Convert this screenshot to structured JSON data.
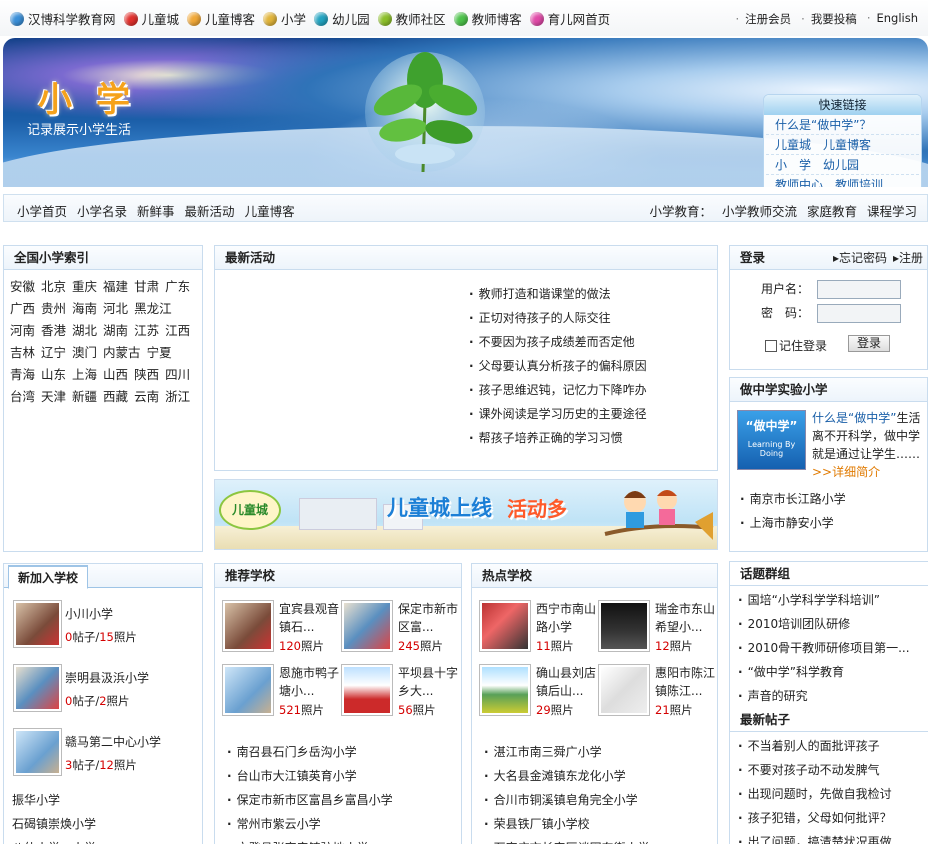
{
  "topnav": [
    {
      "label": "汉博科学教育网",
      "color": "#3a8fd8"
    },
    {
      "label": "儿童城",
      "color": "#e0302c"
    },
    {
      "label": "儿童博客",
      "color": "#f0a838"
    },
    {
      "label": "小学",
      "color": "#e0b43a"
    },
    {
      "label": "幼儿园",
      "color": "#22a3c0"
    },
    {
      "label": "教师社区",
      "color": "#8cbf2a"
    },
    {
      "label": "教师博客",
      "color": "#4cc24a"
    },
    {
      "label": "育儿网首页",
      "color": "#e04aa8"
    }
  ],
  "toplinks": [
    "注册会员",
    "我要投稿",
    "English"
  ],
  "banner": {
    "title": "小学",
    "subtitle": "记录展示小学生活"
  },
  "quick": {
    "title": "快速链接",
    "rows": [
      [
        "什么是“做中学”？"
      ],
      [
        "儿童城",
        "儿童博客"
      ],
      [
        "小　学",
        "幼儿园"
      ],
      [
        "教师中心",
        "教师培训"
      ]
    ]
  },
  "subnav": {
    "left": [
      "小学首页",
      "小学名录",
      "新鲜事",
      "最新活动",
      "儿童博客"
    ],
    "right_label": "小学教育：",
    "right": [
      "小学教师交流",
      "家庭教育",
      "课程学习"
    ]
  },
  "index": {
    "title": "全国小学索引",
    "rows": [
      [
        "安徽",
        "北京",
        "重庆",
        "福建",
        "甘肃",
        "广东"
      ],
      [
        "广西",
        "贵州",
        "海南",
        "河北",
        "黑龙江"
      ],
      [
        "河南",
        "香港",
        "湖北",
        "湖南",
        "江苏",
        "江西"
      ],
      [
        "吉林",
        "辽宁",
        "澳门",
        "内蒙古",
        "宁夏"
      ],
      [
        "青海",
        "山东",
        "上海",
        "山西",
        "陕西",
        "四川"
      ],
      [
        "台湾",
        "天津",
        "新疆",
        "西藏",
        "云南",
        "浙江"
      ]
    ]
  },
  "activity": {
    "title": "最新活动",
    "items": [
      "教师打造和谐课堂的做法",
      "正切对待孩子的人际交往",
      "不要因为孩子成绩差而否定他",
      "父母要认真分析孩子的偏科原因",
      "孩子思维迟钝，记忆力下降咋办",
      "课外阅读是学习历史的主要途径",
      "帮孩子培养正确的学习习惯"
    ]
  },
  "ad": {
    "logo": "儿童城",
    "text1": "儿童城上线",
    "text2": "活动多"
  },
  "login": {
    "title": "登录",
    "forgot": "忘记密码",
    "register": "注册",
    "user_label": "用户名：",
    "pass_label": "密　码：",
    "remember": "记住登录",
    "submit": "登录"
  },
  "zzx": {
    "title": "做中学实验小学",
    "logo_line1": "“做中学”",
    "logo_line2": "Learning By Doing",
    "desc_link": "什么是“做中学”",
    "desc": "生活离不开科学，做中学就是通过让学生……",
    "more": ">>详细简介",
    "schools": [
      "南京市长江路小学",
      "上海市静安小学"
    ]
  },
  "new_schools": {
    "title": "新加入学校",
    "items": [
      {
        "name": "小川小学",
        "posts": "0",
        "photos": "15"
      },
      {
        "name": "崇明县汲浜小学",
        "posts": "0",
        "photos": "2"
      },
      {
        "name": "赣马第二中心小学",
        "posts": "3",
        "photos": "12"
      }
    ],
    "list": [
      "振华小学",
      "石碣镇崇焕小学",
      "八仙小学一小学"
    ],
    "posts_suffix": "帖子/",
    "photos_suffix": "照片"
  },
  "recommend": {
    "title": "推荐学校",
    "items": [
      {
        "name": "宜宾县观音镇石...",
        "photos": "120"
      },
      {
        "name": "保定市新市区富...",
        "photos": "245"
      },
      {
        "name": "恩施市鸭子塘小...",
        "photos": "521"
      },
      {
        "name": "平坝县十字乡大...",
        "photos": "56"
      }
    ],
    "list": [
      "南召县石门乡岳沟小学",
      "台山市大江镇英育小学",
      "保定市新市区富昌乡富昌小学",
      "常州市紫云小学",
      "文登县张家产镇驻地小学"
    ],
    "photos_suffix": "照片"
  },
  "hot": {
    "title": "热点学校",
    "items": [
      {
        "name": "西宁市南山路小学",
        "photos": "11"
      },
      {
        "name": "瑞金市东山希望小...",
        "photos": "12"
      },
      {
        "name": "确山县刘店镇后山...",
        "photos": "29"
      },
      {
        "name": "惠阳市陈江镇陈江...",
        "photos": "21"
      }
    ],
    "list": [
      "湛江市南三舜广小学",
      "大名县金滩镇东龙化小学",
      "合川市铜溪镇皂角完全小学",
      "荣县铁厂镇小学校",
      "石家庄市长安区谈固东街小学"
    ],
    "photos_suffix": "照片"
  },
  "groups": {
    "title": "话题群组",
    "items": [
      "国培“小学科学学科培训”",
      "2010培训团队研修",
      "2010骨干教师研修项目第一...",
      "“做中学”科学教育",
      "声音的研究"
    ]
  },
  "posts": {
    "title": "最新帖子",
    "items": [
      "不当着别人的面批评孩子",
      "不要对孩子动不动发脾气",
      "出现问题时，先做自我检讨",
      "孩子犯错，父母如何批评？",
      "出了问题，搞清楚状况再做"
    ]
  },
  "colors": {
    "accent_blue": "#1a5fa8",
    "count_red": "#d40000",
    "more_orange": "#e07a00"
  }
}
